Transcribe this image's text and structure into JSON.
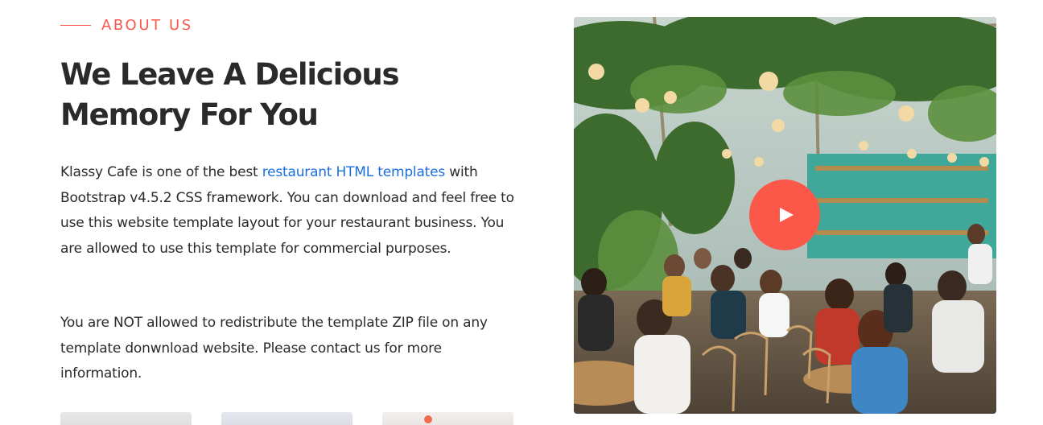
{
  "about": {
    "eyebrow": "ABOUT US",
    "title_line1": "We Leave A Delicious",
    "title_line2": "Memory For You",
    "para1_before": "Klassy Cafe is one of the best ",
    "para1_link": "restaurant HTML templates",
    "para1_after": " with Bootstrap v4.5.2 CSS framework. You can download and feel free to use this website template layout for your restaurant business. You are allowed to use this template for commercial purposes.",
    "para2": "You are NOT allowed to redistribute the template ZIP file on any template donwnload website. Please contact us for more information."
  },
  "video": {
    "play_icon": "play-icon"
  },
  "colors": {
    "accent": "#fb5849",
    "link": "#1a6fe0",
    "text": "#2a2a2a"
  }
}
